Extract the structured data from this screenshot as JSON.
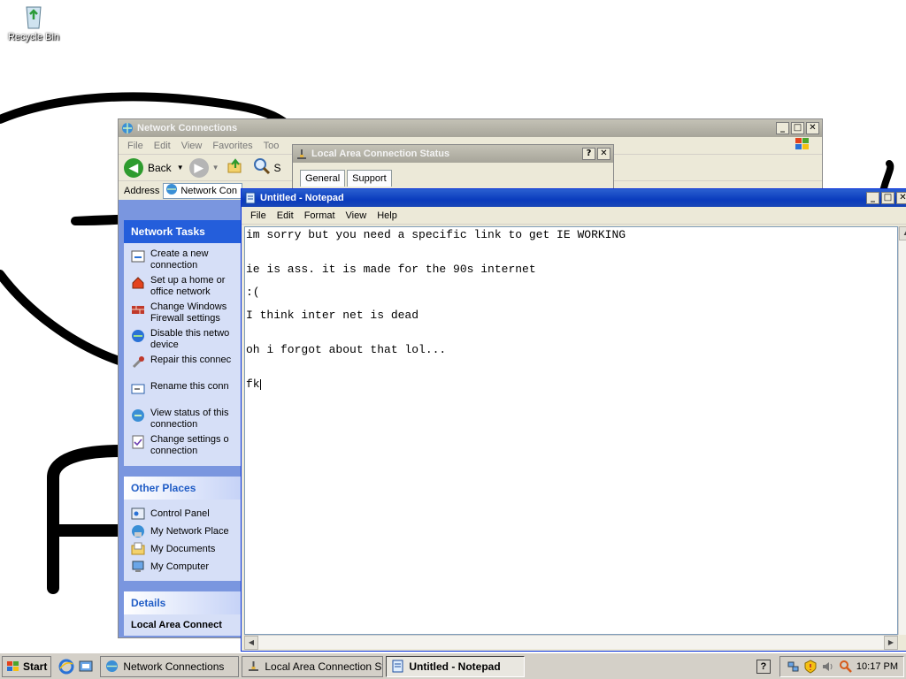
{
  "desktop": {
    "recycle_label": "Recycle Bin"
  },
  "net_window": {
    "title": "Network Connections",
    "menu": [
      "File",
      "Edit",
      "View",
      "Favorites",
      "Too"
    ],
    "back_label": "Back",
    "search_label": "S",
    "address_label": "Address",
    "address_value": "Network Con",
    "network_tasks_title": "Network Tasks",
    "tasks": [
      {
        "icon": "new-connection-icon",
        "label": "Create a new\nconnection"
      },
      {
        "icon": "home-network-icon",
        "label": "Set up a home or\noffice network"
      },
      {
        "icon": "firewall-icon",
        "label": "Change Windows\nFirewall settings"
      },
      {
        "icon": "disable-device-icon",
        "label": "Disable this netwo\ndevice"
      },
      {
        "icon": "repair-icon",
        "label": "Repair this connec"
      },
      {
        "icon": "rename-icon",
        "label": "Rename this conn"
      },
      {
        "icon": "status-icon",
        "label": "View status of this\nconnection"
      },
      {
        "icon": "settings-icon",
        "label": "Change settings o\nconnection"
      }
    ],
    "other_places_title": "Other Places",
    "places": [
      {
        "icon": "control-panel-icon",
        "label": "Control Panel"
      },
      {
        "icon": "network-places-icon",
        "label": "My Network Place"
      },
      {
        "icon": "documents-icon",
        "label": "My Documents"
      },
      {
        "icon": "computer-icon",
        "label": "My Computer"
      }
    ],
    "details_title": "Details",
    "details_item": "Local Area Connect"
  },
  "status_window": {
    "title": "Local Area Connection Status",
    "tabs": [
      "General",
      "Support"
    ]
  },
  "notepad": {
    "title": "Untitled - Notepad",
    "menu": [
      "File",
      "Edit",
      "Format",
      "View",
      "Help"
    ],
    "lines": [
      "im sorry but you need a specific link to get IE WORKING",
      "",
      "",
      "ie is ass. it is made for the 90s internet",
      "",
      ":(",
      "",
      "I think inter net is dead",
      "",
      "",
      "oh i forgot about that lol...",
      "",
      "",
      "fk"
    ]
  },
  "taskbar": {
    "start_label": "Start",
    "buttons": [
      {
        "label": "Network Connections",
        "active": false
      },
      {
        "label": "Local Area Connection St...",
        "active": false
      },
      {
        "label": "Untitled - Notepad",
        "active": true
      }
    ],
    "help_label": "?",
    "clock": "10:17 PM"
  },
  "colors": {
    "title_active": "#0a3bbd",
    "title_inactive": "#b8b6aa",
    "task_panel_header": "#245edb",
    "explorer_bg": "#7a96df"
  }
}
